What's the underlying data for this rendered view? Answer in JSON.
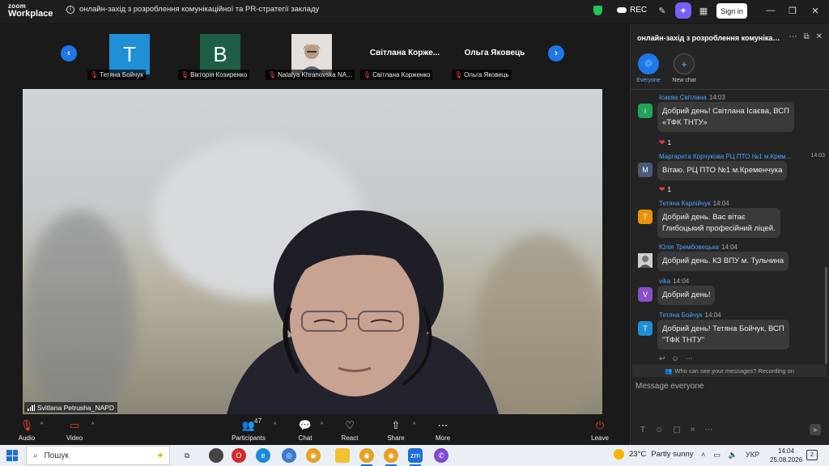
{
  "app": {
    "logo_line1": "zoom",
    "logo_line2": "Workplace",
    "meeting_title": "онлайн-захід з розроблення комунікаційної та PR-стратегії закладу",
    "rec_label": "REC",
    "signin_label": "Sign in"
  },
  "strip": {
    "thumbs": [
      {
        "initial": "T",
        "label": "Тетяна Бойчук",
        "color": "#1f8fd6"
      },
      {
        "initial": "B",
        "label": "Вікторія Козиренко",
        "color": "#1d5e45"
      },
      {
        "initial": "",
        "label": "Natalya Khranovska NA...",
        "color": "#d8d2cc"
      },
      {
        "name_tile": "Світлана  Корже...",
        "label": "Світлана Корженко"
      },
      {
        "name_tile": "Ольга Яковець",
        "label": "Ольга Яковець"
      }
    ]
  },
  "video": {
    "speaker_label": "Svitlana Petrusha_NAPD"
  },
  "chat": {
    "header": "онлайн-захід з розроблення комунікаці...",
    "tabs": [
      {
        "label": "Everyone"
      },
      {
        "label": "New chat"
      }
    ],
    "messages": [
      {
        "sender": "Ісаєва Світлана",
        "time": "14:03",
        "avatar": "i",
        "avatar_color": "#22a35a",
        "text_lines": [
          "Добрий день! Світлана Ісаєва, ВСП",
          "«ТФК ТНТУ»"
        ],
        "reaction_count": "1"
      },
      {
        "sender": "Маргарита Корчукова РЦ ПТО №1 м.Крем...",
        "time": "14:03",
        "avatar": "M",
        "avatar_color": "#4a5a78",
        "text_lines": [
          "Вітаю. РЦ ПТО №1 м.Кременчука"
        ],
        "reaction_count": "1"
      },
      {
        "sender": "Тетяна Карлійчук",
        "time": "14:04",
        "avatar": "T",
        "avatar_color": "#e8920c",
        "text_lines": [
          "Добрий день. Вас вітає",
          "Глибоцький професійний ліцей."
        ]
      },
      {
        "sender": "Юлія Трембовецька",
        "time": "14:04",
        "avatar": "",
        "avatar_color": "#8a8a8a",
        "text_lines": [
          "Добрий день. КЗ ВПУ м. Тульчина"
        ]
      },
      {
        "sender": "vika",
        "time": "14:04",
        "avatar": "V",
        "avatar_color": "#8b4fc7",
        "text_lines": [
          "Добрий день!"
        ]
      },
      {
        "sender": "Тетяна Бойчук",
        "time": "14:04",
        "avatar": "T",
        "avatar_color": "#1f8fd6",
        "text_lines": [
          "Добрий день! Тетяна Бойчук, ВСП",
          "\"ТФК ТНТУ\""
        ]
      }
    ],
    "privacy_note": "Who can see your messages? Recording on",
    "input_placeholder": "Message everyone"
  },
  "toolbar": {
    "audio": "Audio",
    "video": "Video",
    "participants": "Participants",
    "participants_count": "47",
    "chat": "Chat",
    "react": "React",
    "share": "Share",
    "more": "More",
    "leave": "Leave"
  },
  "taskbar": {
    "search_placeholder": "Пошук",
    "weather_temp": "23°C",
    "weather_desc": "Partly sunny",
    "lang": "УКР",
    "time": "14:04",
    "date": "25.08.2026",
    "notif_count": "2"
  }
}
